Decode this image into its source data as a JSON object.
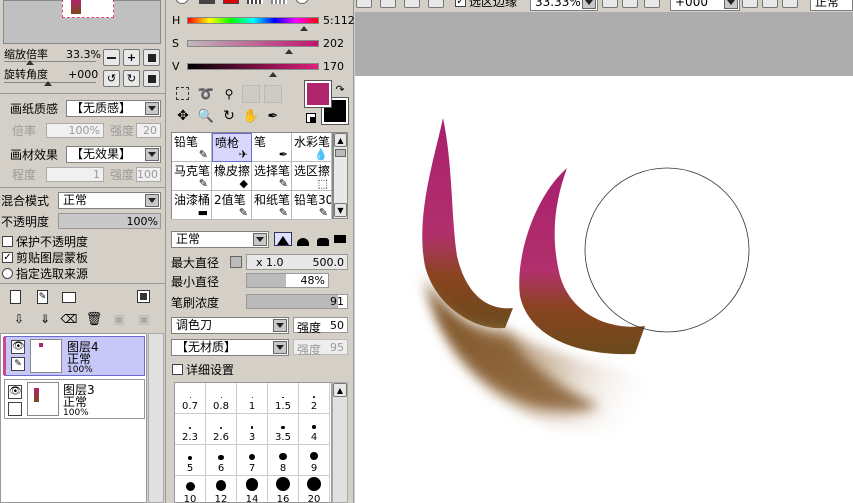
{
  "top_toolbar": {
    "stabilizer_label": "选区边缘",
    "zoom_value": "33.33%",
    "rotate_value": "+000",
    "blend_value": "正常"
  },
  "navigator": {
    "zoom_label": "缩放倍率",
    "zoom_value": "33.3%",
    "rotate_label": "旋转角度",
    "rotate_value": "+000"
  },
  "paper": {
    "texture_label": "画纸质感",
    "texture_value": "【无质感】",
    "rate_label": "倍率",
    "rate_value": "100%",
    "strength_label": "强度",
    "strength_value": "20",
    "effect_label": "画材效果",
    "effect_value": "【无效果】",
    "degree_label": "程度",
    "degree_value": "1",
    "effect_strength_label": "强度",
    "effect_strength_value": "100"
  },
  "layer_props": {
    "blend_label": "混合模式",
    "blend_value": "正常",
    "opacity_label": "不透明度",
    "opacity_value": "100%",
    "protect_opacity": "保护不透明度",
    "clip_mask": "剪贴图层蒙板",
    "selection_source": "指定选取来源"
  },
  "layers": [
    {
      "name": "图层4",
      "mode": "正常",
      "opacity": "100%",
      "selected": true
    },
    {
      "name": "图层3",
      "mode": "正常",
      "opacity": "100%",
      "selected": false
    }
  ],
  "color": {
    "h_label": "H",
    "h_value": "5:112",
    "s_label": "S",
    "s_value": "202",
    "v_label": "V",
    "v_value": "170",
    "fg": "#b0256e",
    "bg": "#000000"
  },
  "brushes": {
    "rows": [
      [
        "铅笔",
        "喷枪",
        "笔",
        "水彩笔"
      ],
      [
        "马克笔",
        "橡皮擦",
        "选择笔",
        "选区擦"
      ],
      [
        "油漆桶",
        "2值笔",
        "和纸笔",
        "铅笔30"
      ]
    ]
  },
  "brush_settings": {
    "mode_value": "正常",
    "max_size_label": "最大直径",
    "max_size_mult": "x 1.0",
    "max_size_value": "500.0",
    "min_size_label": "最小直径",
    "min_size_value": "48%",
    "density_label": "笔刷浓度",
    "density_value": "91",
    "blend_value": "调色刀",
    "blend_strength_label": "强度",
    "blend_strength_value": "50",
    "texture_value": "【无材质】",
    "texture_strength_label": "强度",
    "texture_strength_value": "95",
    "detail_label": "详细设置"
  },
  "size_presets": [
    "0.7",
    "0.8",
    "1",
    "1.5",
    "2",
    "2.3",
    "2.6",
    "3",
    "3.5",
    "4",
    "5",
    "6",
    "7",
    "8",
    "9",
    "10",
    "12",
    "14",
    "16",
    "20"
  ]
}
